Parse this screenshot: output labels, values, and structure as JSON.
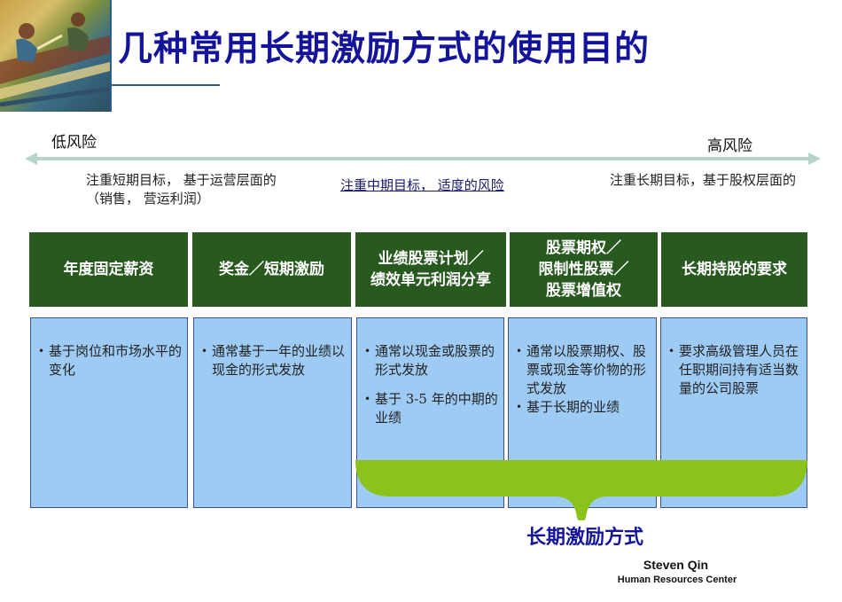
{
  "title": "几种常用长期激励方式的使用目的",
  "risk_scale": {
    "low_label": "低风险",
    "high_label": "高风险"
  },
  "notes": {
    "short_term": "注重短期目标， 基于运营层面的 （销售， 营运利润）",
    "mid_term": "注重中期目标，  适度的风险",
    "long_term": "注重长期目标，基于股权层面的"
  },
  "columns": [
    {
      "header": "年度固定薪资",
      "bullets": [
        "基于岗位和市场水平的变化"
      ]
    },
    {
      "header": "奖金／短期激励",
      "bullets": [
        "通常基于一年的业绩以现金的形式发放"
      ]
    },
    {
      "header": "业绩股票计划／\n绩效单元利润分享",
      "bullets": [
        "通常以现金或股票的形式发放",
        "基于 3-5 年的中期的业绩"
      ]
    },
    {
      "header": "股票期权／\n限制性股票／\n股票增值权",
      "bullets": [
        "通常以股票期权、股票或现金等价物的形式发放",
        "基于长期的业绩"
      ]
    },
    {
      "header": "长期持股的要求",
      "bullets": [
        "要求高级管理人员在任职期间持有适当数量的公司股票"
      ]
    }
  ],
  "brace_label": "长期激励方式",
  "footer": {
    "name": "Steven Qin",
    "org": "Human Resources  Center"
  },
  "colors": {
    "title": "#14149a",
    "header_bg": "#285a1f",
    "cell_bg": "#9dcbf4",
    "brace": "#8cc21c",
    "axis": "#b5d4cc"
  }
}
